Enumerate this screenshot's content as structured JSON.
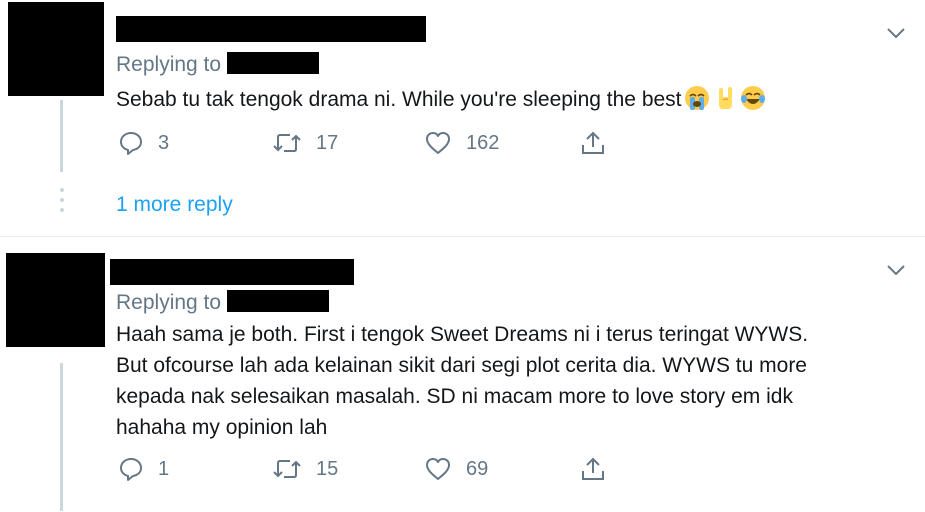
{
  "tweets": [
    {
      "replying_label": "Replying to",
      "text": "Sebab tu tak tengok drama ni. While you're sleeping the best",
      "emojis": [
        "loudly-crying-face",
        "sign-of-the-horns",
        "face-with-tears-of-joy"
      ],
      "replies": "3",
      "retweets": "17",
      "likes": "162",
      "more_replies": "1 more reply"
    },
    {
      "replying_label": "Replying to",
      "text": "Haah sama je both. First i tengok Sweet Dreams ni i terus teringat WYWS.\nBut ofcourse lah ada kelainan sikit dari segi plot cerita dia. WYWS tu more\nkepada nak selesaikan masalah. SD ni macam more to love story em idk\nhahaha my opinion lah",
      "replies": "1",
      "retweets": "15",
      "likes": "69"
    }
  ],
  "colors": {
    "secondary_text": "#657786",
    "link": "#1da1f2",
    "divider": "#e6ecf0",
    "thread": "#ccd6dd"
  },
  "icons": [
    "chevron-down-icon",
    "reply-icon",
    "retweet-icon",
    "like-icon",
    "share-icon"
  ]
}
